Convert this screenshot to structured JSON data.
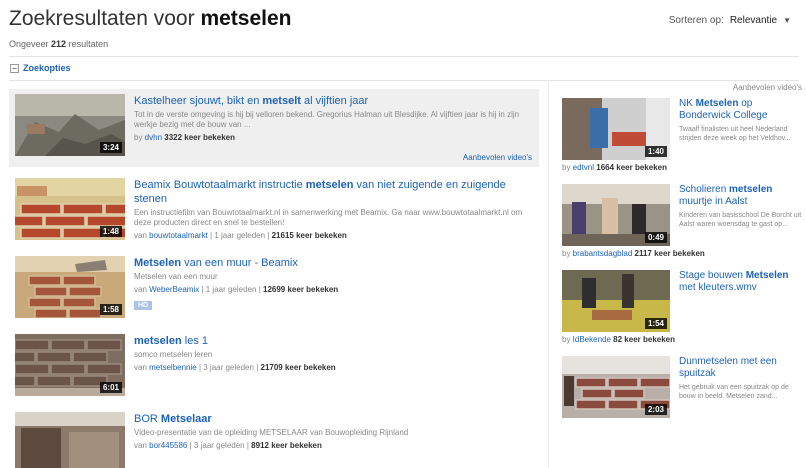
{
  "header": {
    "title_prefix": "Zoekresultaten voor ",
    "query": "metselen",
    "count_prefix": "Ongeveer ",
    "count": "212",
    "count_suffix": " resultaten",
    "sort_label": "Sorteren op:",
    "sort_value": "Relevantie"
  },
  "options_label": "Zoekopties",
  "results": [
    {
      "title_pre": "Kastelheer sjouwt, bikt en ",
      "title_bold": "metselt",
      "title_post": " al vijftien jaar",
      "desc": "Tot in de verste omgeving is hij bij velloren bekend. Gregorius Halman uit Blesdijke. Al vijftien jaar is hij in zijn werkje bezig met de bouw van ...",
      "by": "by ",
      "channel": "dvhn",
      "sep": " ",
      "ago": "",
      "views": "3322 keer bekeken",
      "duration": "3:24",
      "promo_link": "Aanbevolen video's"
    },
    {
      "title_pre": "Beamix Bouwtotaalmarkt instructie ",
      "title_bold": "metselen",
      "title_post": " van niet zuigende en zuigende stenen",
      "desc": "Een instructiefilm van Bouwtotaalmarkt.nl in samenwerking met Beamix. Ga naar www.bouwtotaalmarkt.nl om deze producten direct en snel te bestellen!",
      "by": "van ",
      "channel": "bouwtotaalmarkt",
      "sep": " | ",
      "ago": "1 jaar geleden",
      "views": "21615 keer bekeken",
      "duration": "1:48"
    },
    {
      "title_pre": "",
      "title_bold": "Metselen",
      "title_post": " van een muur - Beamix",
      "desc": "Metselen van een muur",
      "by": "van ",
      "channel": "WeberBeamix",
      "sep": " | ",
      "ago": "1 jaar geleden",
      "views": "12699 keer bekeken",
      "duration": "1:58",
      "badge": "HD"
    },
    {
      "title_pre": "",
      "title_bold": "metselen",
      "title_post": " les 1",
      "desc": "somco metselen leren",
      "by": "van ",
      "channel": "metselbennie",
      "sep": " | ",
      "ago": "3 jaar geleden",
      "views": "21709 keer bekeken",
      "duration": "6:01"
    },
    {
      "title_pre": "BOR ",
      "title_bold": "Metselaar",
      "title_post": "",
      "desc": "Video-presentatie van de opleiding METSELAAR van Bouwopleiding Rijnland",
      "by": "van ",
      "channel": "bor445586",
      "sep": " | ",
      "ago": "3 jaar geleden",
      "views": "8912 keer bekeken",
      "duration": ""
    }
  ],
  "sidebar": {
    "heading": "Aanbevolen video's",
    "items": [
      {
        "title_pre": "NK ",
        "title_bold": "Metselen",
        "title_post": " op Bonderwick College",
        "desc": "Twaalf finalisten uit heel Nederland strijden deze week op het Veldhov...",
        "by": "by ",
        "channel": "edtvnl",
        "views": "1664 keer bekeken",
        "duration": "1:40"
      },
      {
        "title_pre": "Scholieren ",
        "title_bold": "metselen",
        "title_post": " muurtje in Aalst",
        "desc": "Kinderen van basisschool De Borcht uit Aalst waren woensdag te gast op...",
        "by": "by ",
        "channel": "brabantsdagblad",
        "views": "2117 keer bekeken",
        "duration": "0:49"
      },
      {
        "title_pre": "Stage bouwen ",
        "title_bold": "Metselen",
        "title_post": " met kleuters.wmv",
        "desc": "",
        "by": "by ",
        "channel": "IdBekende",
        "views": "82 keer bekeken",
        "duration": "1:54"
      },
      {
        "title_pre": "Dunmetselen met een spuitzak",
        "title_bold": "",
        "title_post": "",
        "desc": "Het gebruik van een spuitzak op de bouw in beeld. Metselen zand...",
        "by": "",
        "channel": "",
        "views": "",
        "duration": "2:03"
      }
    ]
  }
}
